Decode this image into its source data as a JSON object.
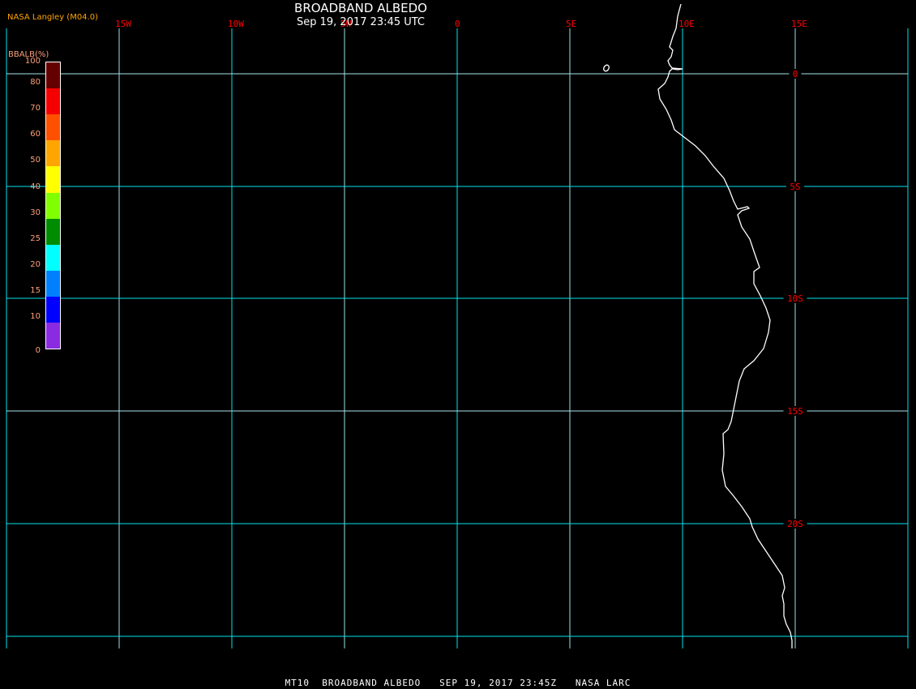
{
  "title": "BROADBAND ALBEDO",
  "subtitle": "Sep 19, 2017 23:45 UTC",
  "credit": "NASA Langley (M04.0)",
  "footer": "MT10  BROADBAND ALBEDO   SEP 19, 2017 23:45Z   NASA LARC",
  "map": {
    "grid_color": "#00e5ee",
    "coast_color": "#ffffff",
    "label_color": "#ff0000",
    "longitude_labels": [
      "15W",
      "10W",
      "5W",
      "0",
      "5E",
      "10E",
      "15E"
    ],
    "latitude_labels": [
      "0",
      "5S",
      "10S",
      "15S",
      "20S"
    ]
  },
  "colorbar": {
    "title": "BBALB(%)",
    "labels": [
      "100",
      "80",
      "70",
      "60",
      "50",
      "40",
      "30",
      "25",
      "20",
      "15",
      "10",
      "0"
    ],
    "colors": [
      "#640000",
      "#f50000",
      "#ff5000",
      "#ffa500",
      "#ffff00",
      "#80ff00",
      "#008c00",
      "#00ffff",
      "#0080ff",
      "#0000ff",
      "#8a2be2"
    ]
  }
}
